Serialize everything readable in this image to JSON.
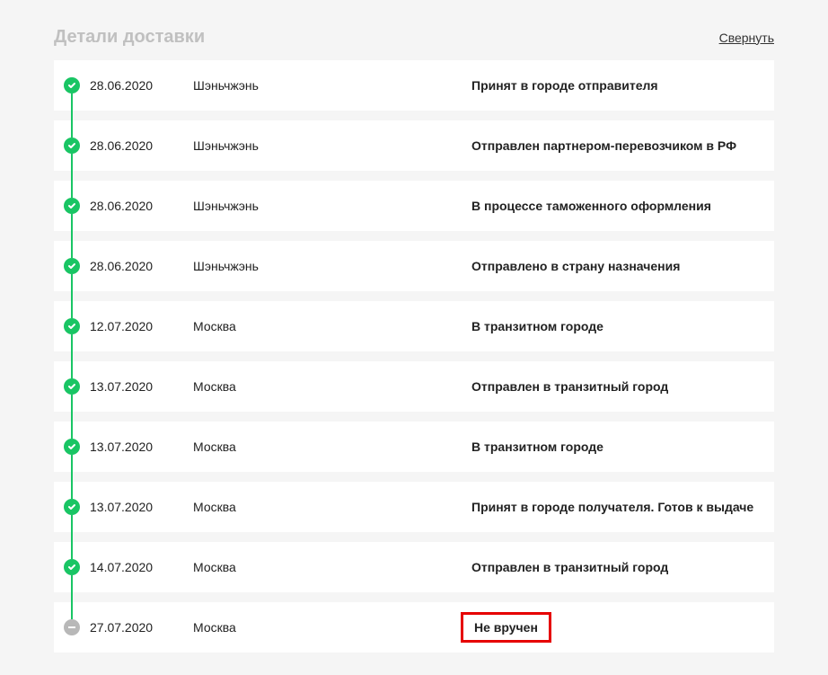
{
  "header": {
    "title": "Детали доставки",
    "collapse_label": "Свернуть"
  },
  "timeline": {
    "items": [
      {
        "date": "28.06.2020",
        "city": "Шэньчжэнь",
        "status": "Принят в городе отправителя",
        "done": true,
        "highlight": false
      },
      {
        "date": "28.06.2020",
        "city": "Шэньчжэнь",
        "status": "Отправлен партнером-перевозчиком в РФ",
        "done": true,
        "highlight": false
      },
      {
        "date": "28.06.2020",
        "city": "Шэньчжэнь",
        "status": "В процессе таможенного оформления",
        "done": true,
        "highlight": false
      },
      {
        "date": "28.06.2020",
        "city": "Шэньчжэнь",
        "status": "Отправлено в страну назначения",
        "done": true,
        "highlight": false
      },
      {
        "date": "12.07.2020",
        "city": "Москва",
        "status": "В транзитном городе",
        "done": true,
        "highlight": false
      },
      {
        "date": "13.07.2020",
        "city": "Москва",
        "status": "Отправлен в транзитный город",
        "done": true,
        "highlight": false
      },
      {
        "date": "13.07.2020",
        "city": "Москва",
        "status": "В транзитном городе",
        "done": true,
        "highlight": false
      },
      {
        "date": "13.07.2020",
        "city": "Москва",
        "status": "Принят в городе получателя. Готов к выдаче",
        "done": true,
        "highlight": false
      },
      {
        "date": "14.07.2020",
        "city": "Москва",
        "status": "Отправлен в транзитный город",
        "done": true,
        "highlight": false
      },
      {
        "date": "27.07.2020",
        "city": "Москва",
        "status": "Не вручен",
        "done": false,
        "highlight": true
      }
    ]
  }
}
